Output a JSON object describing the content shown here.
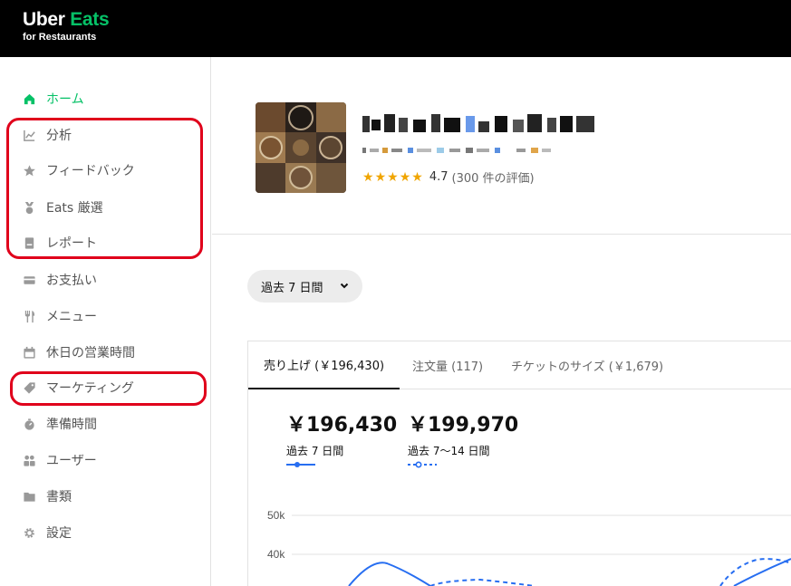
{
  "brand": {
    "name_part1": "Uber ",
    "name_part2": "Eats",
    "subtitle": "for Restaurants",
    "accent": "#06c167"
  },
  "sidebar": {
    "items": [
      {
        "label": "ホーム",
        "icon": "home-icon",
        "active": true
      },
      {
        "label": "分析",
        "icon": "chart-icon"
      },
      {
        "label": "フィードバック",
        "icon": "star-icon"
      },
      {
        "label": "Eats 厳選",
        "icon": "medal-icon"
      },
      {
        "label": "レポート",
        "icon": "report-icon"
      },
      {
        "label": "お支払い",
        "icon": "card-icon"
      },
      {
        "label": "メニュー",
        "icon": "utensils-icon"
      },
      {
        "label": "休日の営業時間",
        "icon": "calendar-icon"
      },
      {
        "label": "マーケティング",
        "icon": "tag-icon"
      },
      {
        "label": "準備時間",
        "icon": "timer-icon"
      },
      {
        "label": "ユーザー",
        "icon": "users-icon"
      },
      {
        "label": "書類",
        "icon": "folder-icon"
      },
      {
        "label": "設定",
        "icon": "gear-icon"
      }
    ]
  },
  "store": {
    "rating": "4.7",
    "rating_count": "(300 件の評価)",
    "stars": 5
  },
  "period": {
    "label": "過去 7 日間"
  },
  "tabs": [
    {
      "label": "売り上げ (￥196,430)",
      "active": true
    },
    {
      "label": "注文量 (117)"
    },
    {
      "label": "チケットのサイズ (￥1,679)"
    }
  ],
  "metrics": {
    "current": {
      "value": "￥196,430",
      "label": "過去 7 日間"
    },
    "previous": {
      "value": "￥199,970",
      "label": "過去 7〜14 日間"
    }
  },
  "chart_data": {
    "type": "line",
    "y_ticks": [
      "50k",
      "40k"
    ],
    "series": [
      {
        "style": "solid",
        "color": "#276ef1"
      },
      {
        "style": "dashed",
        "color": "#276ef1"
      }
    ]
  }
}
